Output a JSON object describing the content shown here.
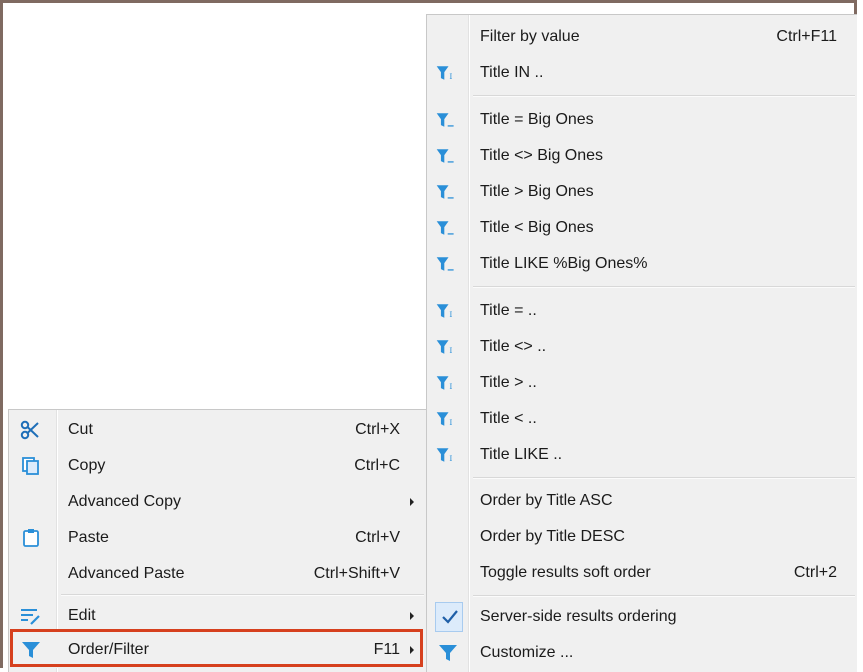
{
  "main_menu": {
    "items": [
      {
        "label": "Cut",
        "shortcut": "Ctrl+X",
        "icon": "scissors-icon"
      },
      {
        "label": "Copy",
        "shortcut": "Ctrl+C",
        "icon": "copy-icon"
      },
      {
        "label": "Advanced Copy",
        "shortcut": "",
        "icon": ""
      },
      {
        "label": "Paste",
        "shortcut": "Ctrl+V",
        "icon": "paste-icon"
      },
      {
        "label": "Advanced Paste",
        "shortcut": "Ctrl+Shift+V",
        "icon": ""
      },
      {
        "label": "Edit",
        "shortcut": "",
        "icon": "edit-icon"
      },
      {
        "label": "Order/Filter",
        "shortcut": "F11",
        "icon": "filter-icon"
      }
    ]
  },
  "sub_menu": {
    "items": [
      {
        "label": "Filter by value",
        "shortcut": "Ctrl+F11"
      },
      {
        "label": "Title IN .."
      },
      {
        "label": "Title = Big Ones"
      },
      {
        "label": "Title <> Big Ones"
      },
      {
        "label": "Title > Big Ones"
      },
      {
        "label": "Title < Big Ones"
      },
      {
        "label": "Title LIKE %Big Ones%"
      },
      {
        "label": "Title = .."
      },
      {
        "label": "Title <> .."
      },
      {
        "label": "Title > .."
      },
      {
        "label": "Title < .."
      },
      {
        "label": "Title LIKE .."
      },
      {
        "label": "Order by Title ASC"
      },
      {
        "label": "Order by Title DESC"
      },
      {
        "label": "Toggle results soft order",
        "shortcut": "Ctrl+2"
      },
      {
        "label": "Server-side results ordering",
        "checked": true
      },
      {
        "label": "Customize ..."
      }
    ]
  },
  "colors": {
    "accent": "#2a8fd8",
    "highlight_border": "#d6401e",
    "menu_bg": "#f0f0f0"
  }
}
